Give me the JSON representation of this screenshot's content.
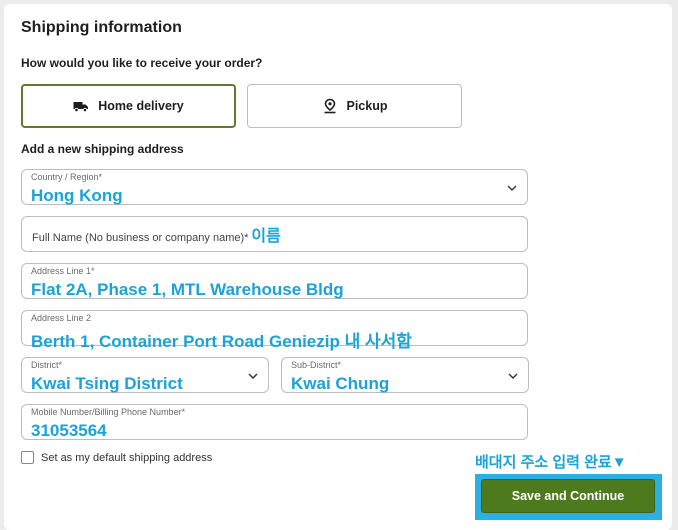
{
  "section": {
    "title": "Shipping information",
    "question": "How would you like to receive your order?",
    "subtitle": "Add a new shipping address"
  },
  "delivery_options": [
    {
      "label": "Home delivery",
      "icon": "truck-icon",
      "selected": true
    },
    {
      "label": "Pickup",
      "icon": "location-pin-icon",
      "selected": false
    }
  ],
  "form": {
    "country": {
      "label": "Country / Region*",
      "value": "Hong Kong"
    },
    "full_name": {
      "placeholder": "Full Name (No business or company name)*",
      "note": "이름"
    },
    "address1": {
      "label": "Address Line 1*",
      "value": "Flat 2A, Phase 1, MTL Warehouse Bldg"
    },
    "address2": {
      "label": "Address Line 2",
      "value": "Berth 1, Container Port Road Geniezip 내 사서함"
    },
    "district": {
      "label": "District*",
      "value": "Kwai Tsing District"
    },
    "sub_district": {
      "label": "Sub-District*",
      "value": "Kwai Chung"
    },
    "mobile": {
      "label": "Mobile Number/Billing Phone Number*",
      "value": "31053564"
    },
    "default_checkbox": {
      "label": "Set as my default shipping address",
      "checked": false
    }
  },
  "annotation": "배대지 주소 입력 완료▼",
  "submit": {
    "label": "Save and Continue"
  },
  "colors": {
    "accent_green": "#4e7a1e",
    "selected_border": "#5d7a2e",
    "annotation_blue": "#1ba3d6",
    "highlight_frame": "#2bb0e0"
  }
}
